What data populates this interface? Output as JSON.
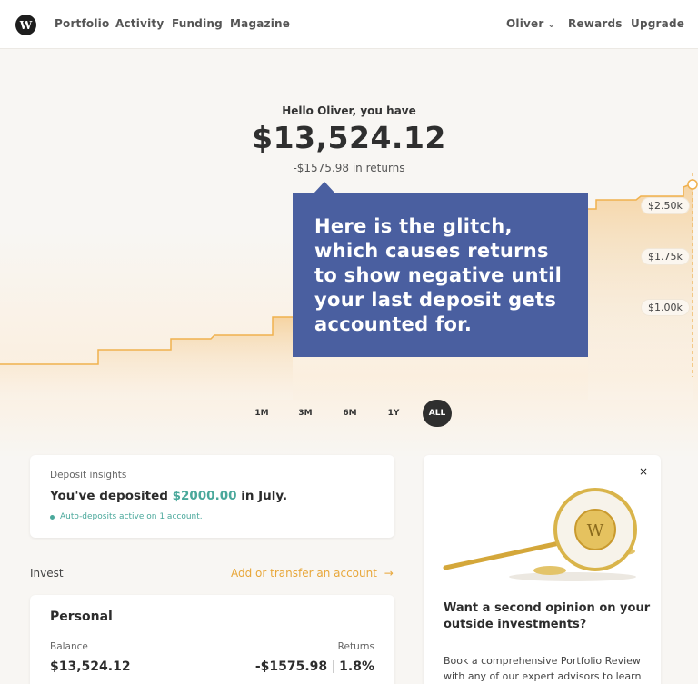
{
  "nav": {
    "logo_letter": "W",
    "left": [
      "Portfolio",
      "Activity",
      "Funding",
      "Magazine"
    ],
    "user": "Oliver",
    "right": [
      "Rewards",
      "Upgrade"
    ]
  },
  "hero": {
    "greeting": "Hello Oliver, you have",
    "balance": "$13,524.12",
    "returns": "-$1575.98 in returns"
  },
  "chart": {
    "price_labels": [
      "$2.50k",
      "$1.75k",
      "$1.00k"
    ],
    "colors": {
      "line": "#f0b14e",
      "fill": "#f6d6a2"
    }
  },
  "callout": {
    "text": "Here is the glitch, which causes returns to show negative until your last deposit gets accounted for.",
    "color": "#4a5fa0"
  },
  "ranges": [
    "1M",
    "3M",
    "6M",
    "1Y",
    "ALL"
  ],
  "active_range": "ALL",
  "deposit": {
    "title": "Deposit insights",
    "prefix": "You've deposited ",
    "amount": "$2000.00",
    "suffix": " in July.",
    "auto": "Auto-deposits active on 1 account."
  },
  "invest": {
    "label": "Invest",
    "add_link": "Add or transfer an account",
    "arrow": "→"
  },
  "personal": {
    "title": "Personal",
    "balance_label": "Balance",
    "returns_label": "Returns",
    "balance_value": "$13,524.12",
    "returns_value": "-$1575.98",
    "returns_pct": "1.8%"
  },
  "promo": {
    "close": "×",
    "heading": "Want a second opinion on your outside investments?",
    "body": "Book a comprehensive Portfolio Review with any of our expert advisors to learn how"
  }
}
